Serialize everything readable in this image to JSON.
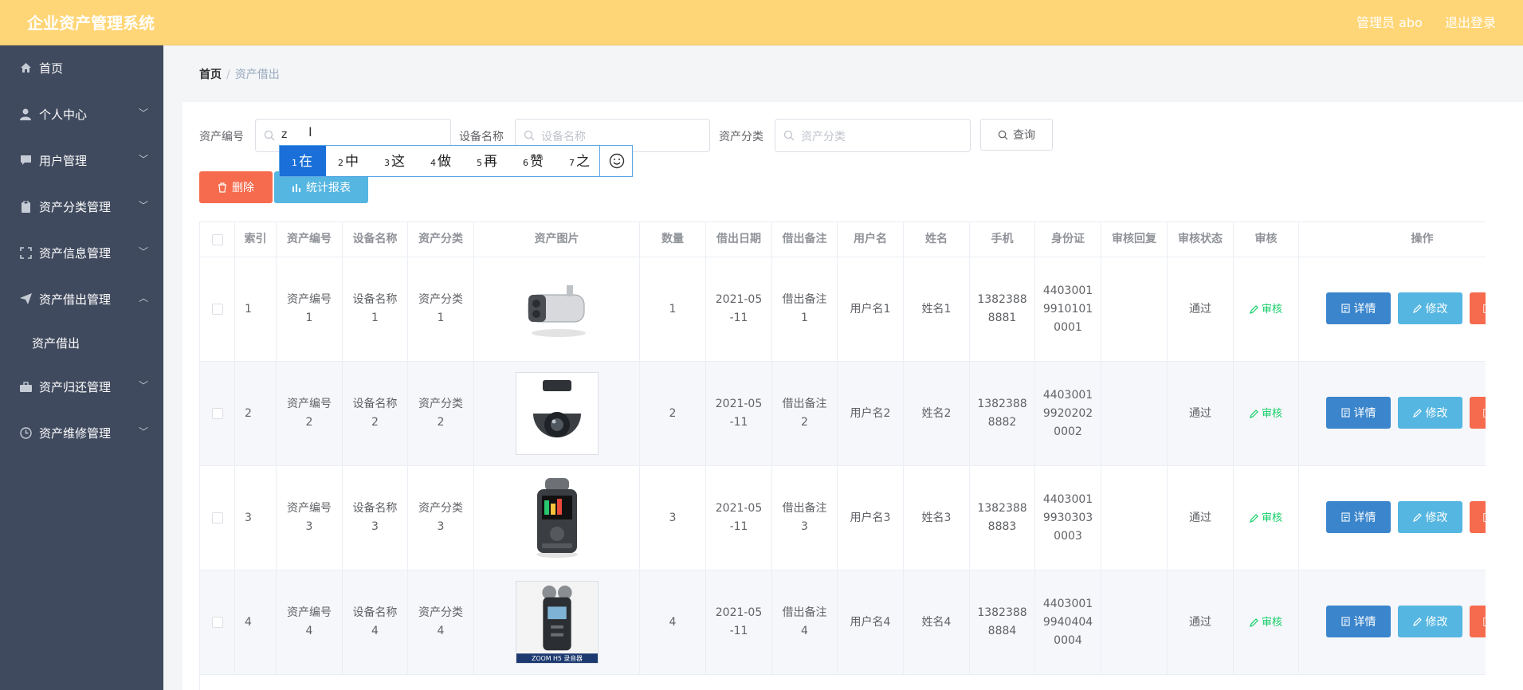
{
  "header": {
    "app_title": "企业资产管理系统",
    "admin_label": "管理员 abo",
    "logout_label": "退出登录"
  },
  "sidebar": {
    "items": [
      {
        "label": "首页",
        "icon": "home-icon"
      },
      {
        "label": "个人中心",
        "icon": "user-icon"
      },
      {
        "label": "用户管理",
        "icon": "chat-icon"
      },
      {
        "label": "资产分类管理",
        "icon": "clipboard-icon"
      },
      {
        "label": "资产信息管理",
        "icon": "frame-icon"
      },
      {
        "label": "资产借出管理",
        "icon": "send-icon"
      },
      {
        "label": "资产归还管理",
        "icon": "briefcase-icon"
      },
      {
        "label": "资产维修管理",
        "icon": "clock-icon"
      }
    ],
    "submenu_label": "资产借出"
  },
  "breadcrumb": {
    "home": "首页",
    "separator": "/",
    "current": "资产借出"
  },
  "search": {
    "asset_no_label": "资产编号",
    "asset_no_value": "z",
    "device_name_label": "设备名称",
    "device_name_placeholder": "设备名称",
    "category_label": "资产分类",
    "category_placeholder": "资产分类",
    "query_label": "查询"
  },
  "ime": {
    "candidates": [
      {
        "n": "1",
        "c": "在"
      },
      {
        "n": "2",
        "c": "中"
      },
      {
        "n": "3",
        "c": "这"
      },
      {
        "n": "4",
        "c": "做"
      },
      {
        "n": "5",
        "c": "再"
      },
      {
        "n": "6",
        "c": "赞"
      },
      {
        "n": "7",
        "c": "之"
      }
    ],
    "emoji_icon": "smile-icon"
  },
  "actions": {
    "delete_label": "删除",
    "report_label": "统计报表"
  },
  "table": {
    "columns": [
      "索引",
      "资产编号",
      "设备名称",
      "资产分类",
      "资产图片",
      "数量",
      "借出日期",
      "借出备注",
      "用户名",
      "姓名",
      "手机",
      "身份证",
      "审核回复",
      "审核状态",
      "审核",
      "操作"
    ],
    "audit_label": "审核",
    "detail_label": "详情",
    "edit_label": "修改",
    "rows": [
      {
        "index": "1",
        "asset_no": "资产编号\n1",
        "device": "设备名称\n1",
        "category": "资产分类\n1",
        "image": "bullet-camera",
        "qty": "1",
        "date": "2021-05\n-11",
        "note": "借出备注\n1",
        "username": "用户名1",
        "name": "姓名1",
        "phone": "1382388\n8881",
        "idcard": "4403001\n9910101\n0001",
        "reply": "",
        "status": "通过"
      },
      {
        "index": "2",
        "asset_no": "资产编号\n2",
        "device": "设备名称\n2",
        "category": "资产分类\n2",
        "image": "dome-camera",
        "qty": "2",
        "date": "2021-05\n-11",
        "note": "借出备注\n2",
        "username": "用户名2",
        "name": "姓名2",
        "phone": "1382388\n8882",
        "idcard": "4403001\n9920202\n0002",
        "reply": "",
        "status": "通过"
      },
      {
        "index": "3",
        "asset_no": "资产编号\n3",
        "device": "设备名称\n3",
        "category": "资产分类\n3",
        "image": "voice-recorder",
        "qty": "3",
        "date": "2021-05\n-11",
        "note": "借出备注\n3",
        "username": "用户名3",
        "name": "姓名3",
        "phone": "1382388\n8883",
        "idcard": "4403001\n9930303\n0003",
        "reply": "",
        "status": "通过"
      },
      {
        "index": "4",
        "asset_no": "资产编号\n4",
        "device": "设备名称\n4",
        "category": "资产分类\n4",
        "image": "zoom-h5-recorder",
        "image_caption": "ZOOM H5 录音器",
        "qty": "4",
        "date": "2021-05\n-11",
        "note": "借出备注\n4",
        "username": "用户名4",
        "name": "姓名4",
        "phone": "1382388\n8884",
        "idcard": "4403001\n9940404\n0004",
        "reply": "",
        "status": "通过"
      }
    ]
  },
  "colors": {
    "topbar": "#ffd677",
    "sidebar": "#404a5e",
    "danger": "#f66b4d",
    "info": "#55b6e1",
    "primary": "#3a85cc",
    "success": "#13ce66"
  }
}
